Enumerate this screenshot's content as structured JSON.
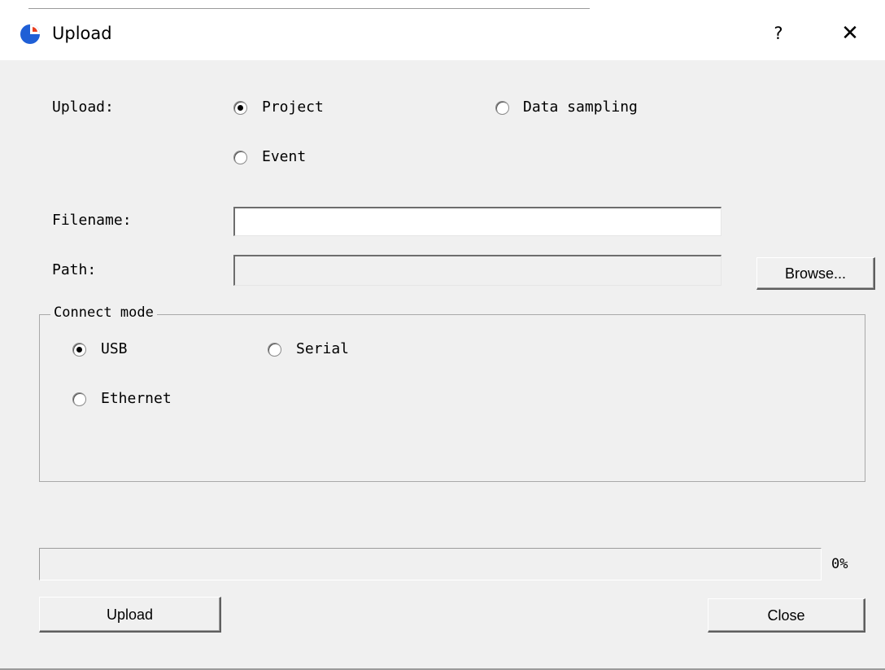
{
  "window": {
    "title": "Upload",
    "help_glyph": "?",
    "close_glyph": "✕",
    "icon": "app-logo-icon",
    "accent": "#1f5fd6"
  },
  "upload_type": {
    "label": "Upload:",
    "options": [
      {
        "label": "Project",
        "selected": true
      },
      {
        "label": "Data sampling",
        "selected": false
      },
      {
        "label": "Event",
        "selected": false
      }
    ]
  },
  "filename": {
    "label": "Filename:",
    "value": ""
  },
  "path": {
    "label": "Path:",
    "value": "",
    "browse_label": "Browse..."
  },
  "connect_mode": {
    "legend": "Connect mode",
    "options": [
      {
        "label": "USB",
        "selected": true
      },
      {
        "label": "Serial",
        "selected": false
      },
      {
        "label": "Ethernet",
        "selected": false
      }
    ]
  },
  "progress": {
    "percent_text": "0%",
    "fraction": 0
  },
  "actions": {
    "upload_label": "Upload",
    "close_label": "Close"
  }
}
